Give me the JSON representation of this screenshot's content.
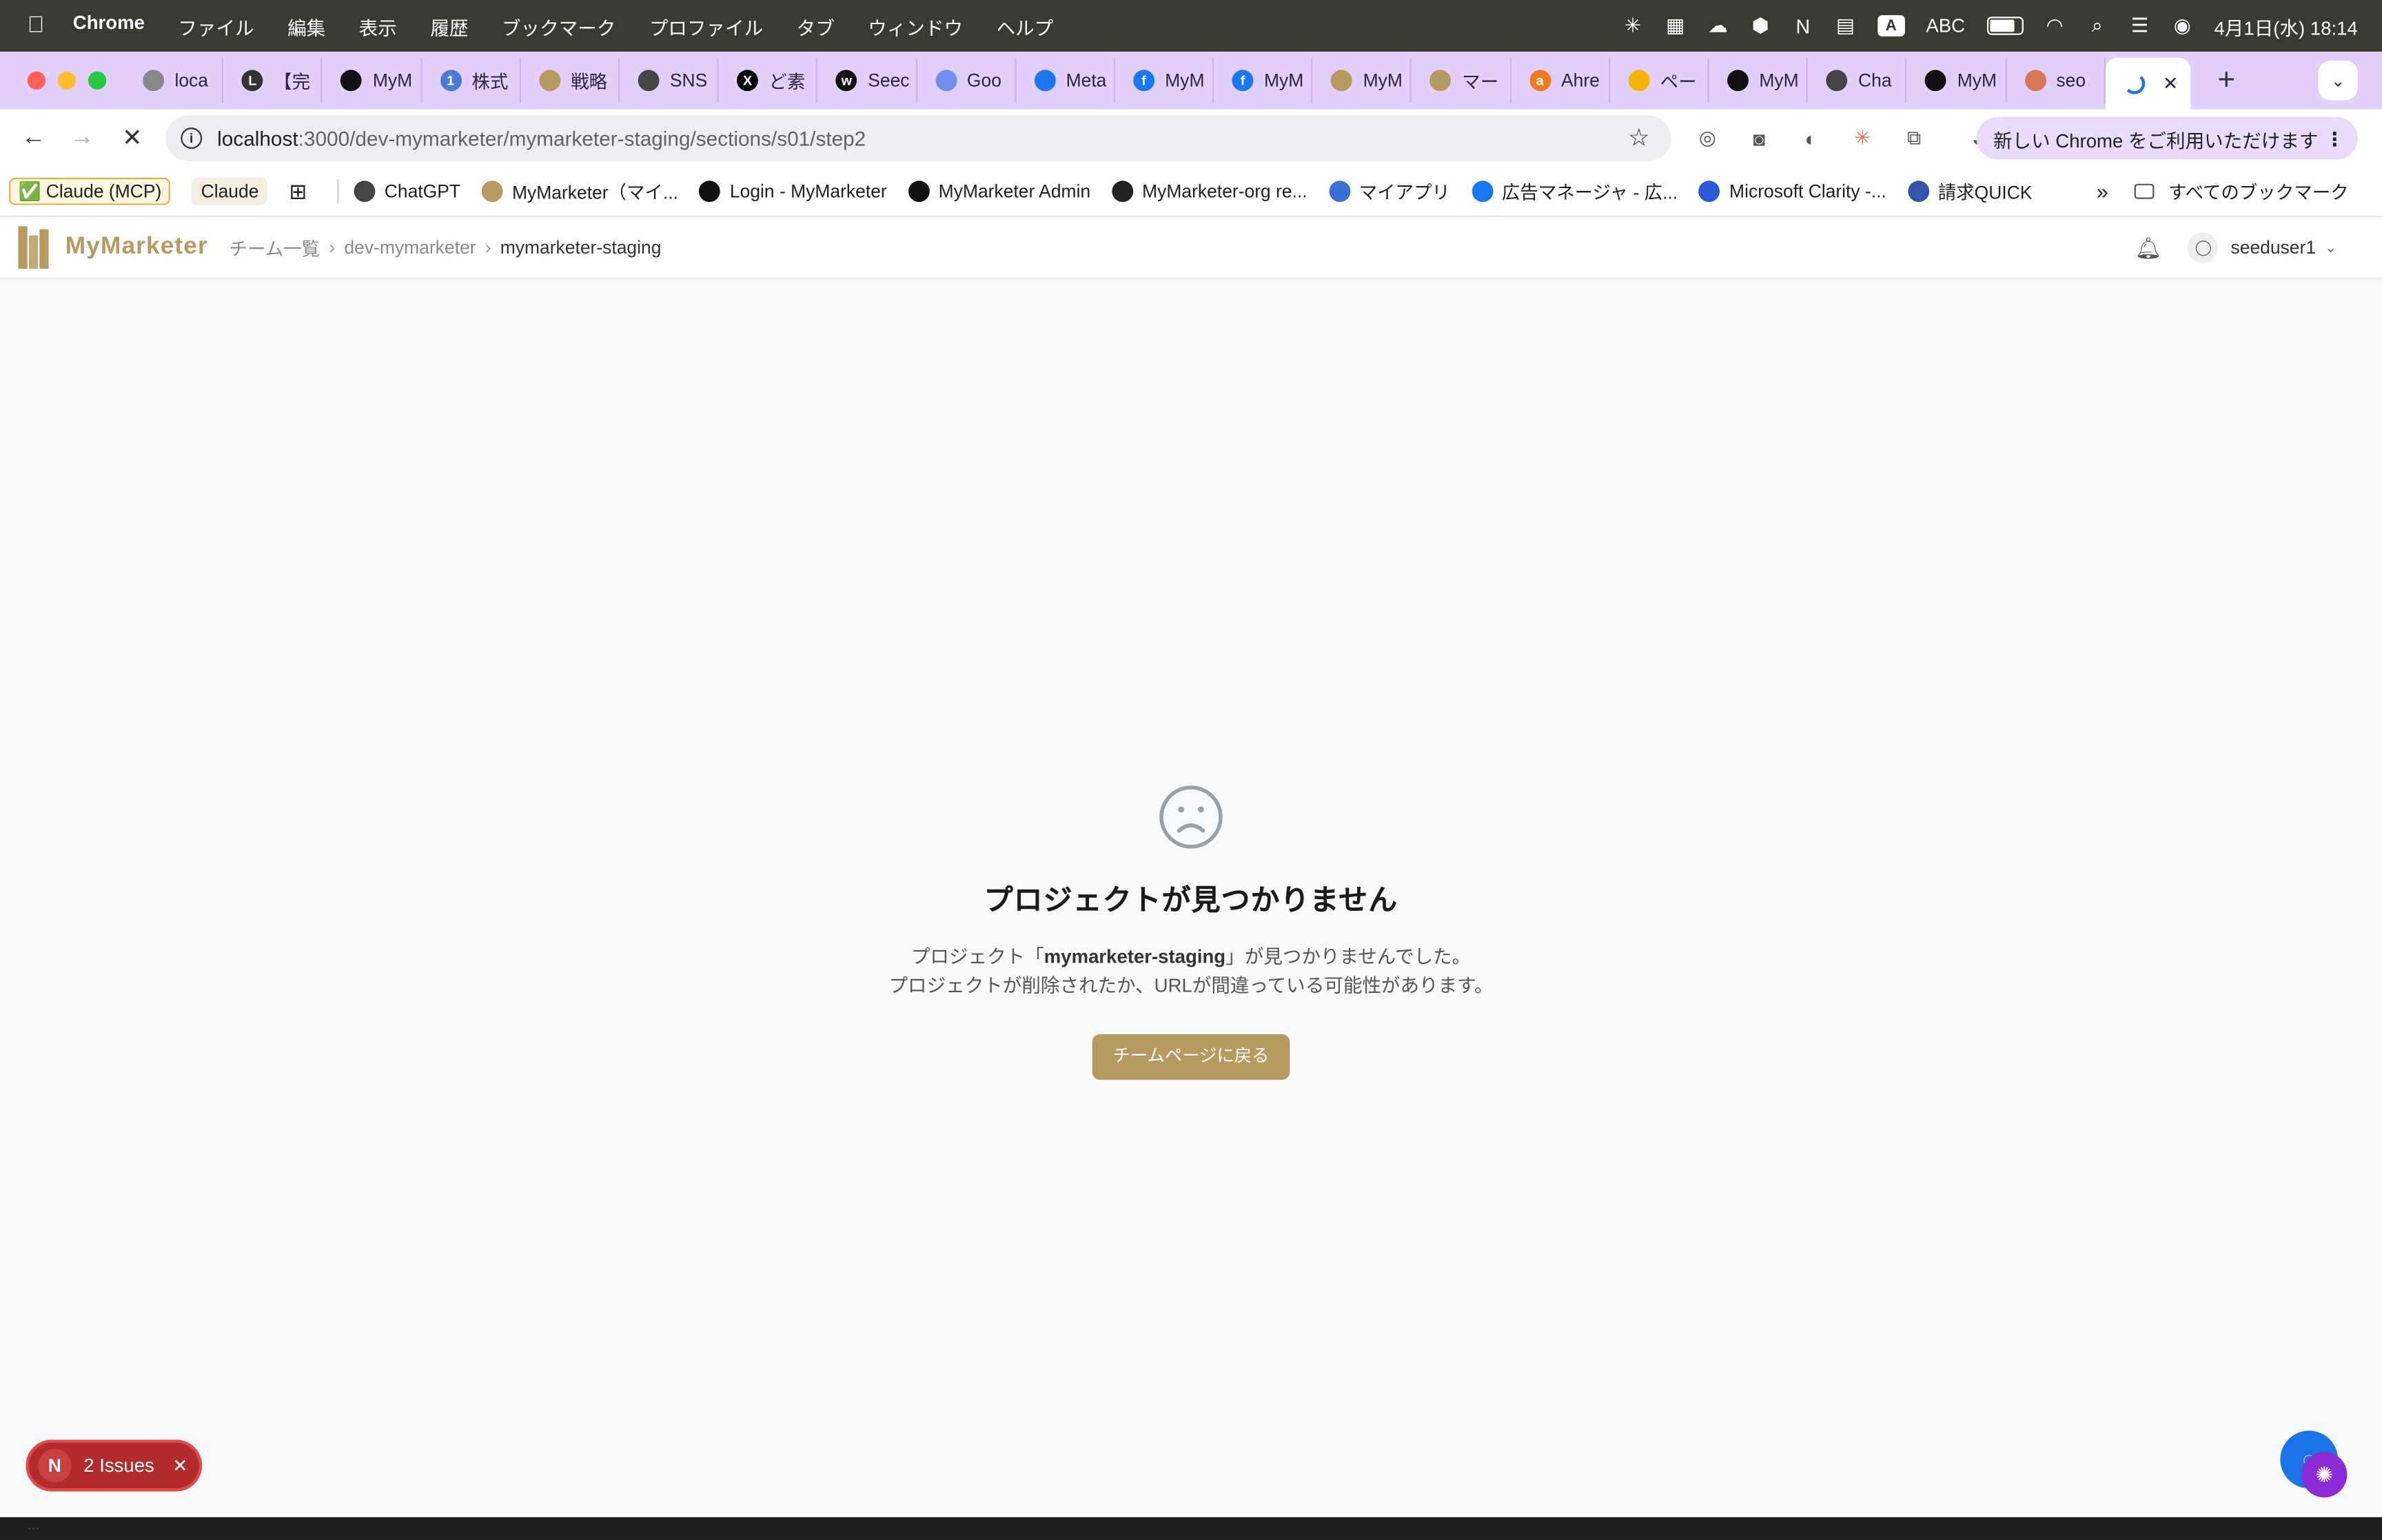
{
  "menubar": {
    "app": "Chrome",
    "menus": [
      "ファイル",
      "編集",
      "表示",
      "履歴",
      "ブックマーク",
      "プロファイル",
      "タブ",
      "ウィンドウ",
      "ヘルプ"
    ],
    "input_mode": "ABC",
    "clock": "4月1日(水) 18:14"
  },
  "tabs": [
    {
      "title": "loca",
      "fav_color": "#888888"
    },
    {
      "title": "【完",
      "fav_color": "#333333",
      "fav_letter": "L"
    },
    {
      "title": "MyM",
      "fav_color": "#111111"
    },
    {
      "title": "株式",
      "fav_color": "#4a7bd4",
      "fav_letter": "1"
    },
    {
      "title": "戦略",
      "fav_color": "#b79a5f"
    },
    {
      "title": "SNS",
      "fav_color": "#444444"
    },
    {
      "title": "ど素",
      "fav_color": "#000000",
      "fav_letter": "X"
    },
    {
      "title": "Seec",
      "fav_color": "#111111",
      "fav_letter": "w"
    },
    {
      "title": "Goo",
      "fav_color": "#6e8ef0"
    },
    {
      "title": "Meta",
      "fav_color": "#1877f2"
    },
    {
      "title": "MyM",
      "fav_color": "#1877f2",
      "fav_letter": "f"
    },
    {
      "title": "MyM",
      "fav_color": "#1877f2",
      "fav_letter": "f"
    },
    {
      "title": "MyM",
      "fav_color": "#b79a5f"
    },
    {
      "title": "マー",
      "fav_color": "#b79a5f"
    },
    {
      "title": "Ahre",
      "fav_color": "#f27a1a",
      "fav_letter": "a"
    },
    {
      "title": "ペー",
      "fav_color": "#f4b400"
    },
    {
      "title": "MyM",
      "fav_color": "#111111"
    },
    {
      "title": "Cha",
      "fav_color": "#444444"
    },
    {
      "title": "MyM",
      "fav_color": "#111111"
    },
    {
      "title": "seo",
      "fav_color": "#d97757"
    }
  ],
  "address": {
    "host": "localhost",
    "path": ":3000/dev-mymarketer/mymarketer-staging/sections/s01/step2"
  },
  "promo": "新しい Chrome をご利用いただけます",
  "bookmarks": [
    {
      "label": "✅ Claude (MCP)",
      "style": "pill1"
    },
    {
      "label": "Claude",
      "style": "pill2"
    },
    {
      "label": "ChatGPT",
      "fav_color": "#444444"
    },
    {
      "label": "MyMarketer（マイ...",
      "fav_color": "#b79a5f"
    },
    {
      "label": "Login - MyMarketer",
      "fav_color": "#111111"
    },
    {
      "label": "MyMarketer Admin",
      "fav_color": "#111111"
    },
    {
      "label": "MyMarketer-org re...",
      "fav_color": "#222222"
    },
    {
      "label": "マイアプリ",
      "fav_color": "#3b6fd8"
    },
    {
      "label": "広告マネージャ - 広...",
      "fav_color": "#1877f2"
    },
    {
      "label": "Microsoft Clarity -...",
      "fav_color": "#2a5bd7"
    },
    {
      "label": "請求QUICK",
      "fav_color": "#3355aa"
    }
  ],
  "all_bookmarks": "すべてのブックマーク",
  "app": {
    "brand": "MyMarketer",
    "breadcrumb": [
      "チーム一覧",
      "dev-mymarketer",
      "mymarketer-staging"
    ],
    "username": "seeduser1"
  },
  "not_found": {
    "title": "プロジェクトが見つかりません",
    "desc_prefix": "プロジェクト「",
    "project_name": "mymarketer-staging",
    "desc_suffix": "」が見つかりませんでした。",
    "desc_line2": "プロジェクトが削除されたか、URLが間違っている可能性があります。",
    "button": "チームページに戻る"
  },
  "issues_badge": "2 Issues",
  "colors": {
    "brand_gold": "#b79a5f",
    "issue_red": "#b42b2b",
    "tabstrip": "#e3cffb"
  }
}
